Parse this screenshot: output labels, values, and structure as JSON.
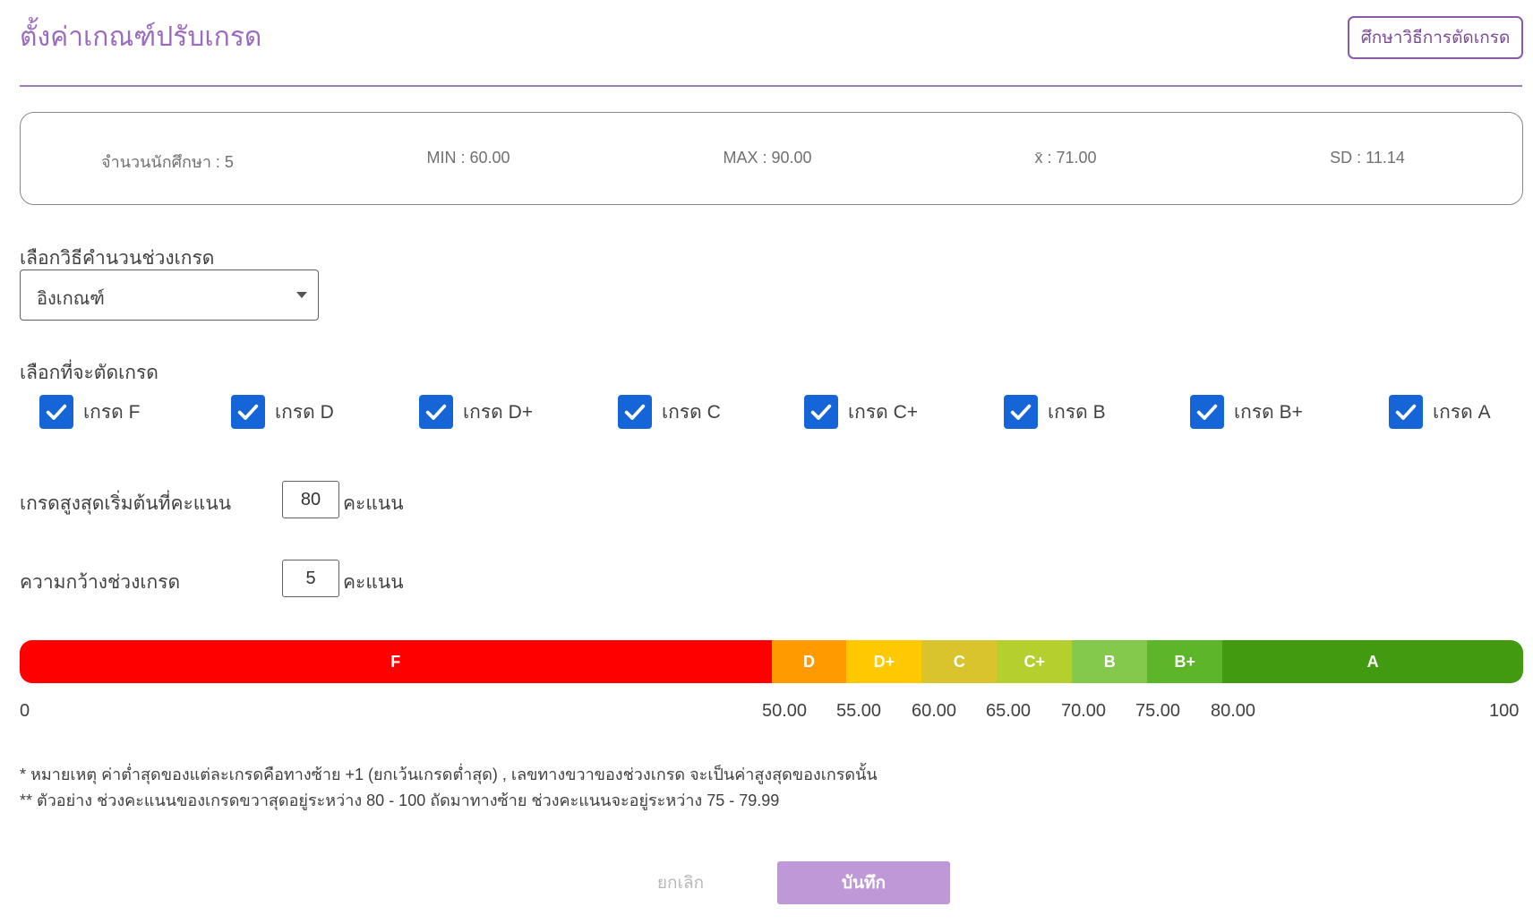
{
  "header": {
    "title": "ตั้งค่าเกณฑ์ปรับเกรด",
    "study_button_label": "ศึกษาวิธีการตัดเกรด"
  },
  "stats": {
    "students": "จำนวนนักศึกษา : 5",
    "min": "MIN : 60.00",
    "max": "MAX : 90.00",
    "mean": "x̄ : 71.00",
    "sd": "SD : 11.14"
  },
  "method": {
    "label": "เลือกวิธีคำนวนช่วงเกรด",
    "selected": "อิงเกณฑ์"
  },
  "grade_select": {
    "label": "เลือกที่จะตัดเกรด",
    "options": [
      {
        "label": "เกรด F",
        "checked": true
      },
      {
        "label": "เกรด D",
        "checked": true
      },
      {
        "label": "เกรด D+",
        "checked": true
      },
      {
        "label": "เกรด C",
        "checked": true
      },
      {
        "label": "เกรด C+",
        "checked": true
      },
      {
        "label": "เกรด B",
        "checked": true
      },
      {
        "label": "เกรด B+",
        "checked": true
      },
      {
        "label": "เกรด A",
        "checked": true
      }
    ]
  },
  "max_grade": {
    "label": "เกรดสูงสุดเริ่มต้นที่คะแนน",
    "value": "80",
    "unit": "คะแนน"
  },
  "width": {
    "label": "ความกว้างช่วงเกรด",
    "value": "5",
    "unit": "คะแนน"
  },
  "grade_bar": {
    "scale_min": 0,
    "scale_max": 100,
    "segments": [
      {
        "grade": "F",
        "from": 0,
        "to": 50,
        "color": "#ff0000"
      },
      {
        "grade": "D",
        "from": 50,
        "to": 55,
        "color": "#ff9a00"
      },
      {
        "grade": "D+",
        "from": 55,
        "to": 60,
        "color": "#ffc800"
      },
      {
        "grade": "C",
        "from": 60,
        "to": 65,
        "color": "#d9c42e"
      },
      {
        "grade": "C+",
        "from": 65,
        "to": 70,
        "color": "#b5cf2f"
      },
      {
        "grade": "B",
        "from": 70,
        "to": 75,
        "color": "#84c84c"
      },
      {
        "grade": "B+",
        "from": 75,
        "to": 80,
        "color": "#5db52a"
      },
      {
        "grade": "A",
        "from": 80,
        "to": 100,
        "color": "#429a10"
      }
    ],
    "ticks": [
      "0",
      "50.00",
      "55.00",
      "60.00",
      "65.00",
      "70.00",
      "75.00",
      "80.00",
      "100"
    ]
  },
  "notes": {
    "line1": "* หมายเหตุ ค่าต่ำสุดของแต่ละเกรดคือทางซ้าย +1 (ยกเว้นเกรดต่ำสุด) , เลขทางขวาของช่วงเกรด จะเป็นค่าสูงสุดของเกรดนั้น",
    "line2": "** ตัวอย่าง ช่วงคะแนนของเกรดขวาสุดอยู่ระหว่าง 80 - 100 ถัดมาทางซ้าย ช่วงคะแนนจะอยู่ระหว่าง 75 - 79.99"
  },
  "footer": {
    "cancel_label": "ยกเลิก",
    "save_label": "บันทึก"
  }
}
